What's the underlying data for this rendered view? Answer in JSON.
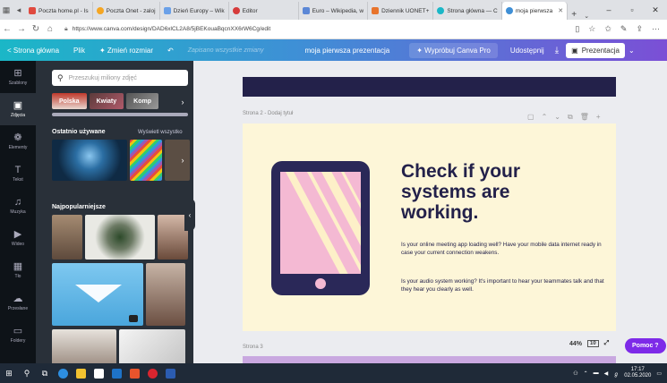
{
  "browser": {
    "tabs": [
      {
        "label": "Poczta home.pl - Is",
        "color": "#e04a3f"
      },
      {
        "label": "Poczta Onet - zaloj",
        "color": "#f5a623"
      },
      {
        "label": "Dzień Europy – Wik",
        "color": "#6aa0e8"
      },
      {
        "label": "Editor",
        "color": "#d63b3b"
      },
      {
        "label": "Euro – Wikipedia, w",
        "color": "#5b87d6"
      },
      {
        "label": "Dziennik UONET+",
        "color": "#e8742c"
      },
      {
        "label": "Strona główna — C",
        "color": "#1bb7c7"
      },
      {
        "label": "moja pierwsza",
        "color": "#3f8fd6",
        "active": true
      }
    ],
    "url": "https://www.canva.com/design/DAD6xlCL2A8/5jBEKouaBqcnXX6rW6Cg/edit"
  },
  "header": {
    "home": "< Strona główna",
    "file": "Plik",
    "resize": "✦ Zmień rozmiar",
    "saved": "Zapisano wszystkie zmiany",
    "title": "moja pierwsza prezentacja",
    "try_pro": "✦ Wypróbuj Canva Pro",
    "share": "Udostępnij",
    "present": "Prezentacja"
  },
  "rail": [
    {
      "label": "Szablony",
      "icon": "⊞"
    },
    {
      "label": "Zdjęcia",
      "icon": "▣",
      "active": true
    },
    {
      "label": "Elementy",
      "icon": "❁"
    },
    {
      "label": "Tekst",
      "icon": "T"
    },
    {
      "label": "Muzyka",
      "icon": "♫"
    },
    {
      "label": "Wideo",
      "icon": "▶"
    },
    {
      "label": "Tło",
      "icon": "▦"
    },
    {
      "label": "Przesłane",
      "icon": "☁"
    },
    {
      "label": "Foldery",
      "icon": "▭"
    }
  ],
  "panel": {
    "search_placeholder": "Przeszukuj miliony zdjęć",
    "chips": [
      "Polska",
      "Kwiaty",
      "Komp"
    ],
    "recent_title": "Ostatnio używane",
    "recent_link": "Wyświetl wszystko",
    "popular_title": "Najpopularniejsze"
  },
  "canvas": {
    "page2_label": "Strona 2 - Dodaj tytuł",
    "page3_label": "Strona 3",
    "headline": "Check if your systems are working.",
    "body1": "Is your online meeting app loading well? Have your mobile data internet ready in case your current connection weakens.",
    "body2": "Is your audio system working? It's important to hear your teammates talk and that they hear you clearly as well.",
    "zoom": "44%",
    "page_count": "10",
    "help": "Pomoc ?"
  },
  "taskbar": {
    "time": "17:17",
    "date": "02.05.2020"
  }
}
